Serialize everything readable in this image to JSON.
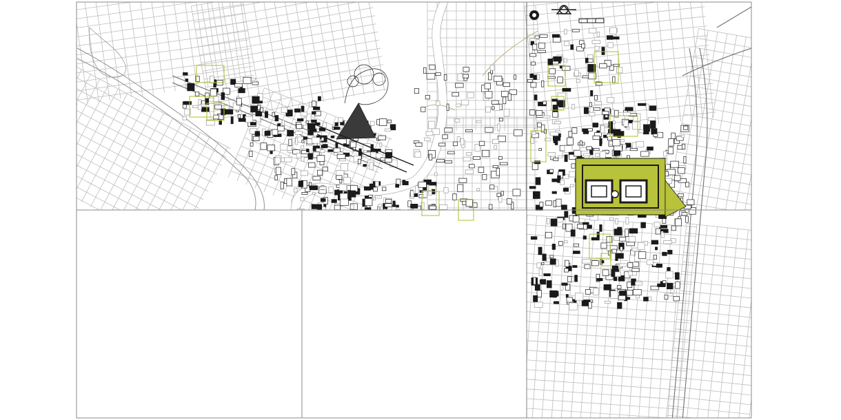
{
  "drawing": {
    "background": "#ffffff",
    "colors": {
      "frame": "#8a8a8a",
      "street": "#bdbdbd",
      "street_dark": "#6e6e6e",
      "building": "#1a1a1a",
      "hatch": "#9a9a9a",
      "highlight": "#b8c23a",
      "river_edge": "#8f8f8f",
      "curve": "#b4a86a"
    },
    "icons": [
      "compass-icon",
      "north-arrow-icon",
      "scale-bar-icon"
    ],
    "panels": [
      {
        "id": "top-strip",
        "state": "drawn"
      },
      {
        "id": "bottom-left",
        "state": "empty"
      },
      {
        "id": "bottom-middle",
        "state": "empty"
      },
      {
        "id": "bottom-right",
        "state": "drawn"
      }
    ]
  }
}
